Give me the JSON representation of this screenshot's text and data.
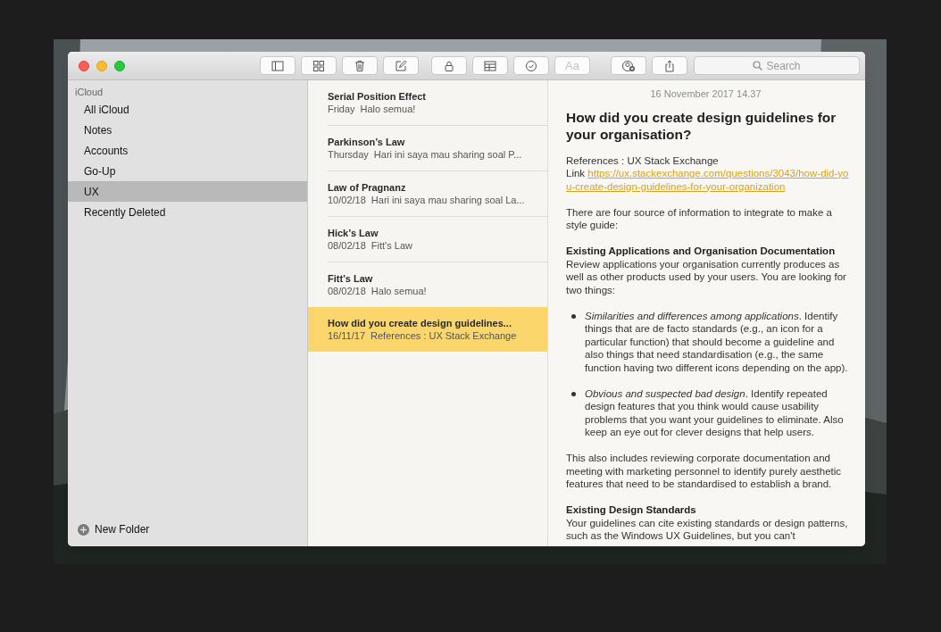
{
  "toolbar": {
    "buttons": [
      {
        "kind": "sidebar"
      },
      {
        "kind": "grid"
      },
      {
        "kind": "trash"
      },
      {
        "kind": "compose"
      },
      {
        "kind": "lock"
      },
      {
        "kind": "table"
      },
      {
        "kind": "checklist"
      },
      {
        "kind": "format",
        "label": "Aa",
        "disabled": true
      },
      {
        "kind": "collaborate"
      },
      {
        "kind": "share"
      }
    ],
    "search": {
      "placeholder": "Search"
    }
  },
  "sidebar": {
    "section": "iCloud",
    "items": [
      {
        "label": "All iCloud",
        "selected": false
      },
      {
        "label": "Notes",
        "selected": false
      },
      {
        "label": "Accounts",
        "selected": false
      },
      {
        "label": "Go-Up",
        "selected": false
      },
      {
        "label": "UX",
        "selected": true
      },
      {
        "label": "Recently Deleted",
        "selected": false
      }
    ],
    "new_folder": "New Folder"
  },
  "notes": [
    {
      "title": "Serial Position Effect",
      "date": "Friday",
      "preview": "Halo semua!",
      "selected": false
    },
    {
      "title": "Parkinson’s Law",
      "date": "Thursday",
      "preview": "Hari ini saya mau sharing soal P...",
      "selected": false
    },
    {
      "title": "Law of Pragnanz",
      "date": "10/02/18",
      "preview": "Hari ini saya mau sharing soal La...",
      "selected": false
    },
    {
      "title": "Hick’s Law",
      "date": "08/02/18",
      "preview": "Fitt's Law",
      "selected": false
    },
    {
      "title": "Fitt’s Law",
      "date": "08/02/18",
      "preview": "Halo semua!",
      "selected": false
    },
    {
      "title": "How did you create design guidelines...",
      "date": "16/11/17",
      "preview": "References : UX Stack Exchange",
      "selected": true
    }
  ],
  "note": {
    "date": "16 November 2017 14.37",
    "title": "How did you create design guidelines for your organisation?",
    "blocks": [
      {
        "kind": "text",
        "text": "References : UX Stack Exchange"
      },
      {
        "kind": "link",
        "label": "Link",
        "url": "https://ux.stackexchange.com/questions/3043/how-did-you-create-design-guidelines-for-your-organization"
      },
      {
        "kind": "gap"
      },
      {
        "kind": "text",
        "text": "There are four source of information to integrate to make a style guide:"
      },
      {
        "kind": "gap"
      },
      {
        "kind": "heading",
        "text": "Existing Applications and Organisation Documentation"
      },
      {
        "kind": "text",
        "text": "Review applications your organisation currently produces as well as other products used by your users. You are looking for two things:"
      },
      {
        "kind": "gap"
      },
      {
        "kind": "bullet",
        "text": "*Similarities and differences among applications*. Identify things that are de facto standards (e.g., an icon for a particular function) that should become a guideline and also things that need standardisation (e.g., the same function having two different icons depending on the app)."
      },
      {
        "kind": "gap"
      },
      {
        "kind": "bullet",
        "text": "*Obvious and suspected bad design*. Identify repeated design features that you think would cause usability problems that you want your guidelines to eliminate. Also keep an eye out for clever designs that help users."
      },
      {
        "kind": "gap"
      },
      {
        "kind": "text",
        "text": "This also includes reviewing corporate documentation and meeting with marketing personnel to identify purely aesthetic features that need to be standardised to establish a brand."
      },
      {
        "kind": "gap"
      },
      {
        "kind": "heading",
        "text": "Existing Design Standards"
      },
      {
        "kind": "text",
        "text": "Your guidelines can cite existing standards or design patterns, such as the Windows UX Guidelines, but you can't"
      }
    ]
  }
}
